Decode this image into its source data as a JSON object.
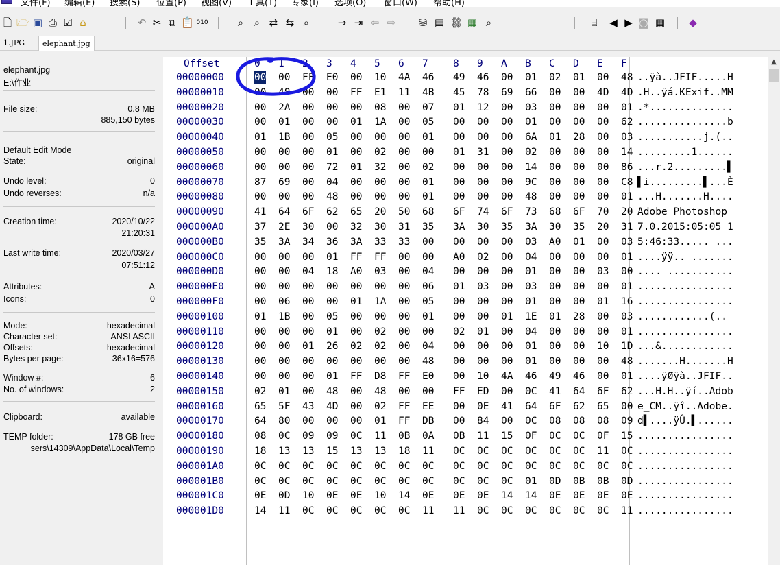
{
  "menu": [
    "文件(F)",
    "编辑(E)",
    "搜索(S)",
    "位置(P)",
    "视图(V)",
    "工具(T)",
    "专家(I)",
    "选项(O)",
    "窗口(W)",
    "帮助(H)"
  ],
  "tabs": [
    "1.JPG",
    "elephant.jpg"
  ],
  "side": {
    "filename": "elephant.jpg",
    "folder": "E:\\作业",
    "file_size_label": "File size:",
    "file_size_mb": "0.8 MB",
    "file_size_bytes": "885,150 bytes",
    "edit_mode_label": "Default Edit Mode",
    "state_label": "State:",
    "state": "original",
    "undo_level_label": "Undo level:",
    "undo_level": "0",
    "undo_reverses_label": "Undo reverses:",
    "undo_reverses": "n/a",
    "creation_label": "Creation time:",
    "creation_date": "2020/10/22",
    "creation_time": "21:20:31",
    "lastwrite_label": "Last write time:",
    "lastwrite_date": "2020/03/27",
    "lastwrite_time": "07:51:12",
    "attributes_label": "Attributes:",
    "attributes": "A",
    "icons_label": "Icons:",
    "icons": "0",
    "mode_label": "Mode:",
    "mode": "hexadecimal",
    "charset_label": "Character set:",
    "charset": "ANSI ASCII",
    "offsets_label": "Offsets:",
    "offsets": "hexadecimal",
    "bpp_label": "Bytes per page:",
    "bpp": "36x16=576",
    "window_label": "Window #:",
    "window": "6",
    "nwin_label": "No. of windows:",
    "nwin": "2",
    "clip_label": "Clipboard:",
    "clip": "available",
    "temp_label": "TEMP folder:",
    "temp_free": "178 GB free",
    "temp_path": "sers\\14309\\AppData\\Local\\Temp"
  },
  "hex": {
    "offset_header": "Offset",
    "col_headers": [
      "0",
      "1",
      "2",
      "3",
      "4",
      "5",
      "6",
      "7",
      "8",
      "9",
      "A",
      "B",
      "C",
      "D",
      "E",
      "F"
    ],
    "rows": [
      {
        "off": "00000000",
        "b": "00 00 FF E0 00 10 4A 46 49 46 00 01 02 01 00 48",
        "a": "..ÿà..JFIF.....H"
      },
      {
        "off": "00000010",
        "b": "00 48 00 00 FF E1 11 4B 45 78 69 66 00 00 4D 4D",
        "a": ".H..ÿá.KExif..MM"
      },
      {
        "off": "00000020",
        "b": "00 2A 00 00 00 08 00 07 01 12 00 03 00 00 00 01",
        "a": ".*.............."
      },
      {
        "off": "00000030",
        "b": "00 01 00 00 01 1A 00 05 00 00 00 01 00 00 00 62",
        "a": "...............b"
      },
      {
        "off": "00000040",
        "b": "01 1B 00 05 00 00 00 01 00 00 00 6A 01 28 00 03",
        "a": "...........j.(.."
      },
      {
        "off": "00000050",
        "b": "00 00 00 01 00 02 00 00 01 31 00 02 00 00 00 14",
        "a": ".........1......"
      },
      {
        "off": "00000060",
        "b": "00 00 00 72 01 32 00 02 00 00 00 14 00 00 00 86",
        "a": "...r.2.........▌"
      },
      {
        "off": "00000070",
        "b": "87 69 00 04 00 00 00 01 00 00 00 9C 00 00 00 C8",
        "a": "▌i.........▌...È"
      },
      {
        "off": "00000080",
        "b": "00 00 00 48 00 00 00 01 00 00 00 48 00 00 00 01",
        "a": "...H.......H...."
      },
      {
        "off": "00000090",
        "b": "41 64 6F 62 65 20 50 68 6F 74 6F 73 68 6F 70 20",
        "a": "Adobe Photoshop "
      },
      {
        "off": "000000A0",
        "b": "37 2E 30 00 32 30 31 35 3A 30 35 3A 30 35 20 31",
        "a": "7.0.2015:05:05 1"
      },
      {
        "off": "000000B0",
        "b": "35 3A 34 36 3A 33 33 00 00 00 00 03 A0 01 00 03",
        "a": "5:46:33..... ..."
      },
      {
        "off": "000000C0",
        "b": "00 00 00 01 FF FF 00 00 A0 02 00 04 00 00 00 01",
        "a": "....ÿÿ.. ......."
      },
      {
        "off": "000000D0",
        "b": "00 00 04 18 A0 03 00 04 00 00 00 01 00 00 03 00",
        "a": ".... ..........."
      },
      {
        "off": "000000E0",
        "b": "00 00 00 00 00 00 00 06 01 03 00 03 00 00 00 01",
        "a": "................"
      },
      {
        "off": "000000F0",
        "b": "00 06 00 00 01 1A 00 05 00 00 00 01 00 00 01 16",
        "a": "................"
      },
      {
        "off": "00000100",
        "b": "01 1B 00 05 00 00 00 01 00 00 01 1E 01 28 00 03",
        "a": "............(.."
      },
      {
        "off": "00000110",
        "b": "00 00 00 01 00 02 00 00 02 01 00 04 00 00 00 01",
        "a": "................"
      },
      {
        "off": "00000120",
        "b": "00 00 01 26 02 02 00 04 00 00 00 01 00 00 10 1D",
        "a": "...&............"
      },
      {
        "off": "00000130",
        "b": "00 00 00 00 00 00 00 48 00 00 00 01 00 00 00 48",
        "a": ".......H.......H"
      },
      {
        "off": "00000140",
        "b": "00 00 00 01 FF D8 FF E0 00 10 4A 46 49 46 00 01",
        "a": "....ÿØÿà..JFIF.."
      },
      {
        "off": "00000150",
        "b": "02 01 00 48 00 48 00 00 FF ED 00 0C 41 64 6F 62",
        "a": "...H.H..ÿí..Adob"
      },
      {
        "off": "00000160",
        "b": "65 5F 43 4D 00 02 FF EE 00 0E 41 64 6F 62 65 00",
        "a": "e_CM..ÿî..Adobe."
      },
      {
        "off": "00000170",
        "b": "64 80 00 00 00 01 FF DB 00 84 00 0C 08 08 08 09",
        "a": "d▌....ÿÛ.▌......"
      },
      {
        "off": "00000180",
        "b": "08 0C 09 09 0C 11 0B 0A 0B 11 15 0F 0C 0C 0F 15",
        "a": "................"
      },
      {
        "off": "00000190",
        "b": "18 13 13 15 13 13 18 11 0C 0C 0C 0C 0C 0C 11 0C",
        "a": "................"
      },
      {
        "off": "000001A0",
        "b": "0C 0C 0C 0C 0C 0C 0C 0C 0C 0C 0C 0C 0C 0C 0C 0C",
        "a": "................"
      },
      {
        "off": "000001B0",
        "b": "0C 0C 0C 0C 0C 0C 0C 0C 0C 0C 0C 01 0D 0B 0B 0D",
        "a": "................"
      },
      {
        "off": "000001C0",
        "b": "0E 0D 10 0E 0E 10 14 0E 0E 0E 14 14 0E 0E 0E 0E",
        "a": "................"
      },
      {
        "off": "000001D0",
        "b": "14 11 0C 0C 0C 0C 0C 11 11 0C 0C 0C 0C 0C 0C 11",
        "a": "................"
      }
    ]
  },
  "colors": {
    "offset_text": "#00007a",
    "cursor_bg": "#0a246a",
    "annotation": "#1a1ae0"
  }
}
